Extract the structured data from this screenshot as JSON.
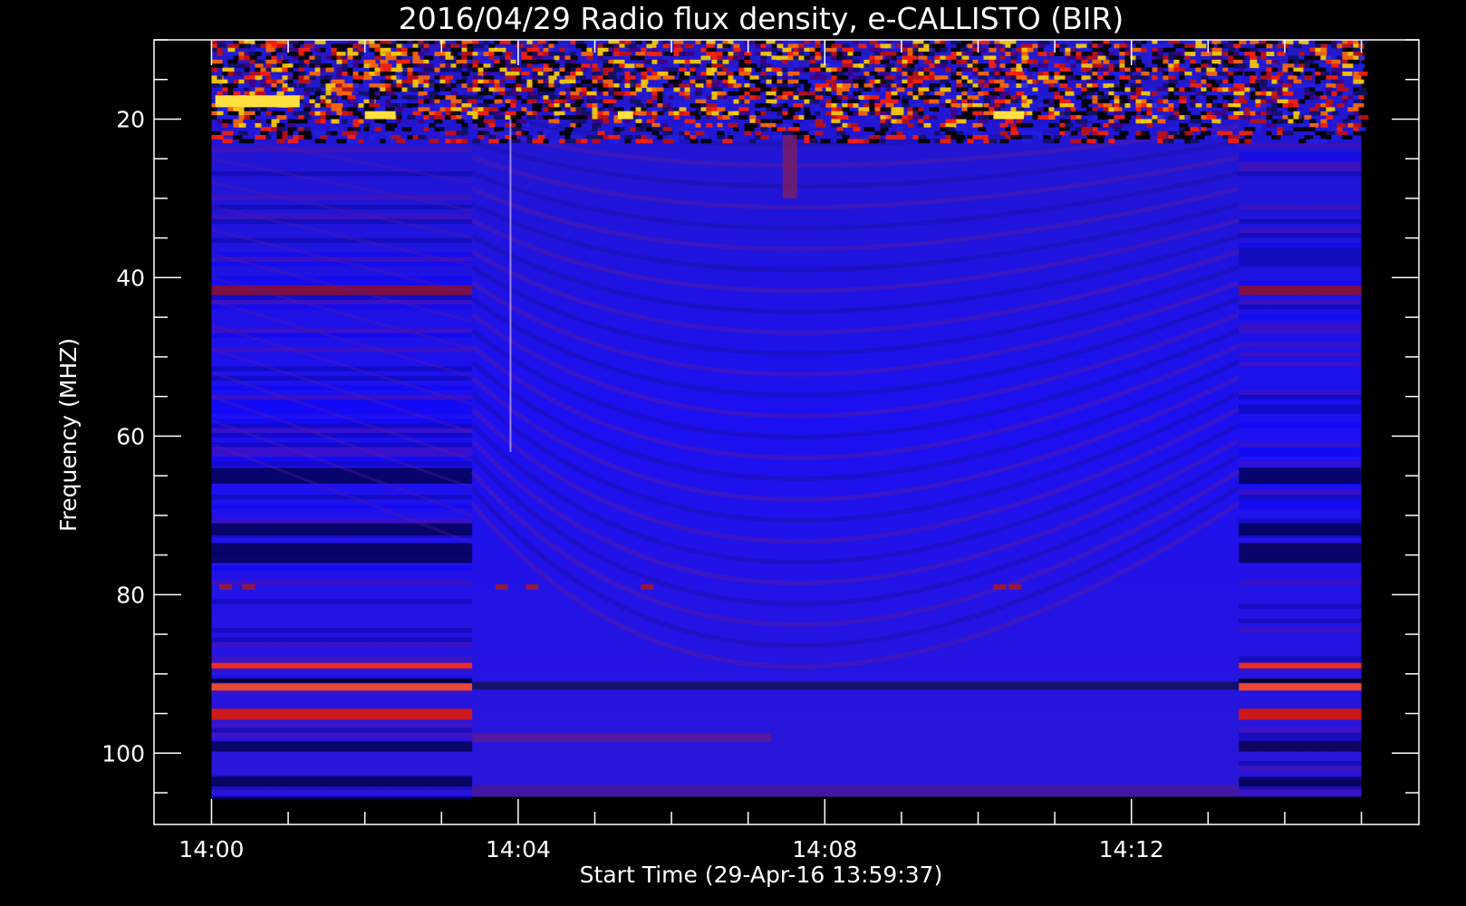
{
  "chart_data": {
    "type": "heatmap",
    "title": "2016/04/29  Radio flux density, e-CALLISTO (BIR)",
    "xlabel": "Start Time (29-Apr-16 13:59:37)",
    "ylabel": "Frequency (MHZ)",
    "x_ticks": [
      "14:00",
      "14:04",
      "14:08",
      "14:12"
    ],
    "x_tick_minutes": [
      0,
      4,
      8,
      12
    ],
    "xlim_minutes": [
      -0.75,
      15.75
    ],
    "data_time_range_minutes": [
      0,
      15
    ],
    "y_ticks": [
      20,
      40,
      60,
      80,
      100
    ],
    "y_minor_step": 5,
    "ylim": [
      10,
      109
    ],
    "y_inverted": true,
    "data_freq_range": [
      10,
      105.5
    ],
    "colormap": [
      "#000000",
      "#0a0aff",
      "#ff1a00",
      "#ffff40",
      "#ffffff"
    ],
    "segments_minutes": [
      [
        0,
        3.4
      ],
      [
        3.4,
        13.4
      ],
      [
        13.4,
        15
      ]
    ],
    "features": {
      "noisy_band_mhz": [
        10,
        23
      ],
      "strong_lines_mhz": [
        89,
        91.3,
        95,
        99
      ],
      "dark_lines_mhz": [
        90.5,
        104
      ],
      "interference_line_mhz": 91.5
    }
  }
}
